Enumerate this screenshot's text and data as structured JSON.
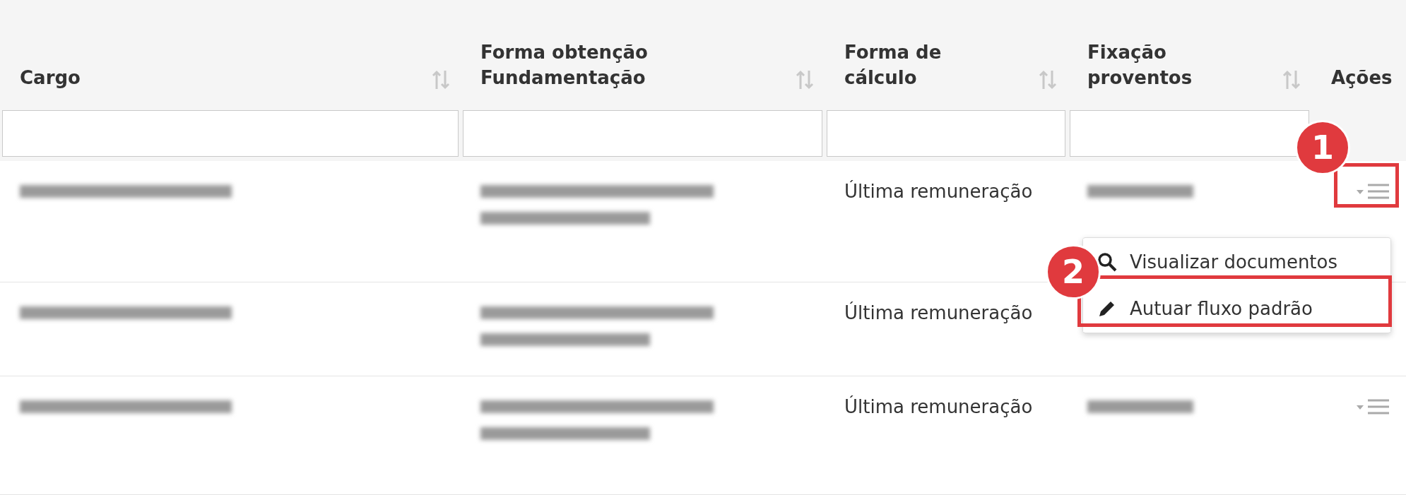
{
  "table": {
    "columns": [
      {
        "label": "Cargo",
        "sortable": true
      },
      {
        "label": "Forma obtenção\nFundamentação",
        "sortable": true
      },
      {
        "label": "Forma de\ncálculo",
        "sortable": true
      },
      {
        "label": "Fixação\nproventos",
        "sortable": true
      },
      {
        "label": "Ações",
        "sortable": false
      }
    ],
    "rows": [
      {
        "forma_calculo": "Última remuneração",
        "menu_open": true
      },
      {
        "forma_calculo": "Última remuneração",
        "menu_open": false
      },
      {
        "forma_calculo": "Última remuneração",
        "menu_open": false
      }
    ]
  },
  "actions_menu": {
    "items": [
      {
        "kind": "view",
        "label": "Visualizar documentos"
      },
      {
        "kind": "edit",
        "label": "Autuar fluxo padrão"
      }
    ]
  },
  "annotations": [
    {
      "label": "1"
    },
    {
      "label": "2"
    }
  ]
}
